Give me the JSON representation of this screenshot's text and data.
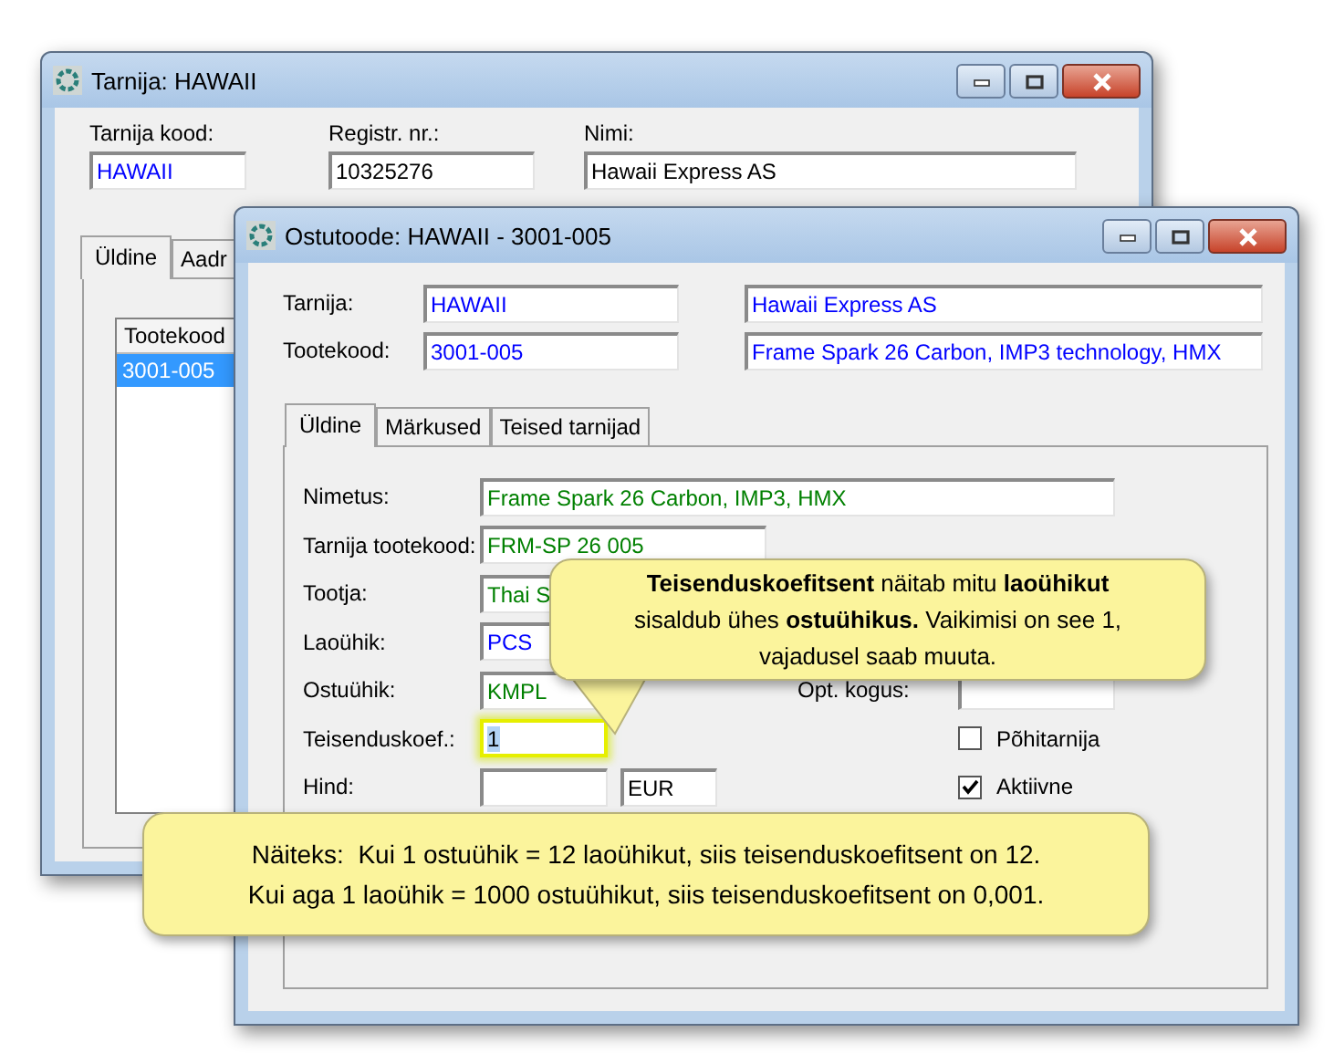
{
  "supplier_window": {
    "title": "Tarnija: HAWAII",
    "fields": [
      {
        "label": "Tarnija kood:",
        "value": "HAWAII",
        "color": "#0000ff"
      },
      {
        "label": "Registr. nr.:",
        "value": "10325276",
        "color": "#000000"
      },
      {
        "label": "Nimi:",
        "value": "Hawaii Express AS",
        "color": "#000000"
      }
    ],
    "tabs": [
      {
        "label": "Üldine",
        "selected": true
      },
      {
        "label": "Aadr",
        "selected": false
      }
    ],
    "product_list": {
      "column": "Tootekood",
      "rows": [
        {
          "text": "3001-005",
          "selected": true
        }
      ]
    }
  },
  "product_window": {
    "title": "Ostutoode: HAWAII - 3001-005",
    "header": [
      {
        "label": "Tarnija:",
        "code": "HAWAII",
        "name": "Hawaii Express AS"
      },
      {
        "label": "Tootekood:",
        "code": "3001-005",
        "name": "Frame Spark 26 Carbon, IMP3 technology, HMX"
      }
    ],
    "tabs": [
      {
        "label": "Üldine",
        "selected": true
      },
      {
        "label": "Märkused",
        "selected": false
      },
      {
        "label": "Teised tarnijad",
        "selected": false
      }
    ],
    "form": [
      {
        "label": "Nimetus:",
        "kind": "wide",
        "value": "Frame Spark 26 Carbon, IMP3, HMX",
        "color": "#008000"
      },
      {
        "label": "Tarnija tootekood:",
        "kind": "medium",
        "value": "FRM-SP 26 005",
        "color": "#008000"
      },
      {
        "label": "Tootja:",
        "kind": "medium",
        "value": "Thai S",
        "color": "#008000"
      },
      {
        "label": "Laoühik:",
        "kind": "normal",
        "value": "PCS",
        "color": "#0000ff"
      },
      {
        "label": "Ostuühik:",
        "kind": "normal",
        "value": "KMPL",
        "color": "#008000",
        "side": {
          "kind": "field",
          "label": "Opt. kogus:"
        }
      },
      {
        "label": "Teisenduskoef.:",
        "kind": "highlighted",
        "value": "1",
        "color": "#000000",
        "side": {
          "kind": "checkbox",
          "label": "Põhitarnija",
          "checked": false
        }
      },
      {
        "label": "Hind:",
        "kind": "price",
        "currency": "EUR",
        "side": {
          "kind": "checkbox",
          "label": "Aktiivne",
          "checked": true
        }
      }
    ]
  },
  "callouts": [
    {
      "text": "**Teisenduskoefitsent** näitab mitu **laoühikut** sisaldub ühes **ostuühikus.** Vaikimisi on see 1, vajadusel saab muuta."
    },
    {
      "lines": [
        "Näiteks:  Kui 1 ostuühik = 12 laoühikut, siis teisenduskoefitsent on 12.",
        "Kui aga 1 laoühik = 1000 ostuühikut, siis teisenduskoefitsent on 0,001."
      ]
    }
  ]
}
